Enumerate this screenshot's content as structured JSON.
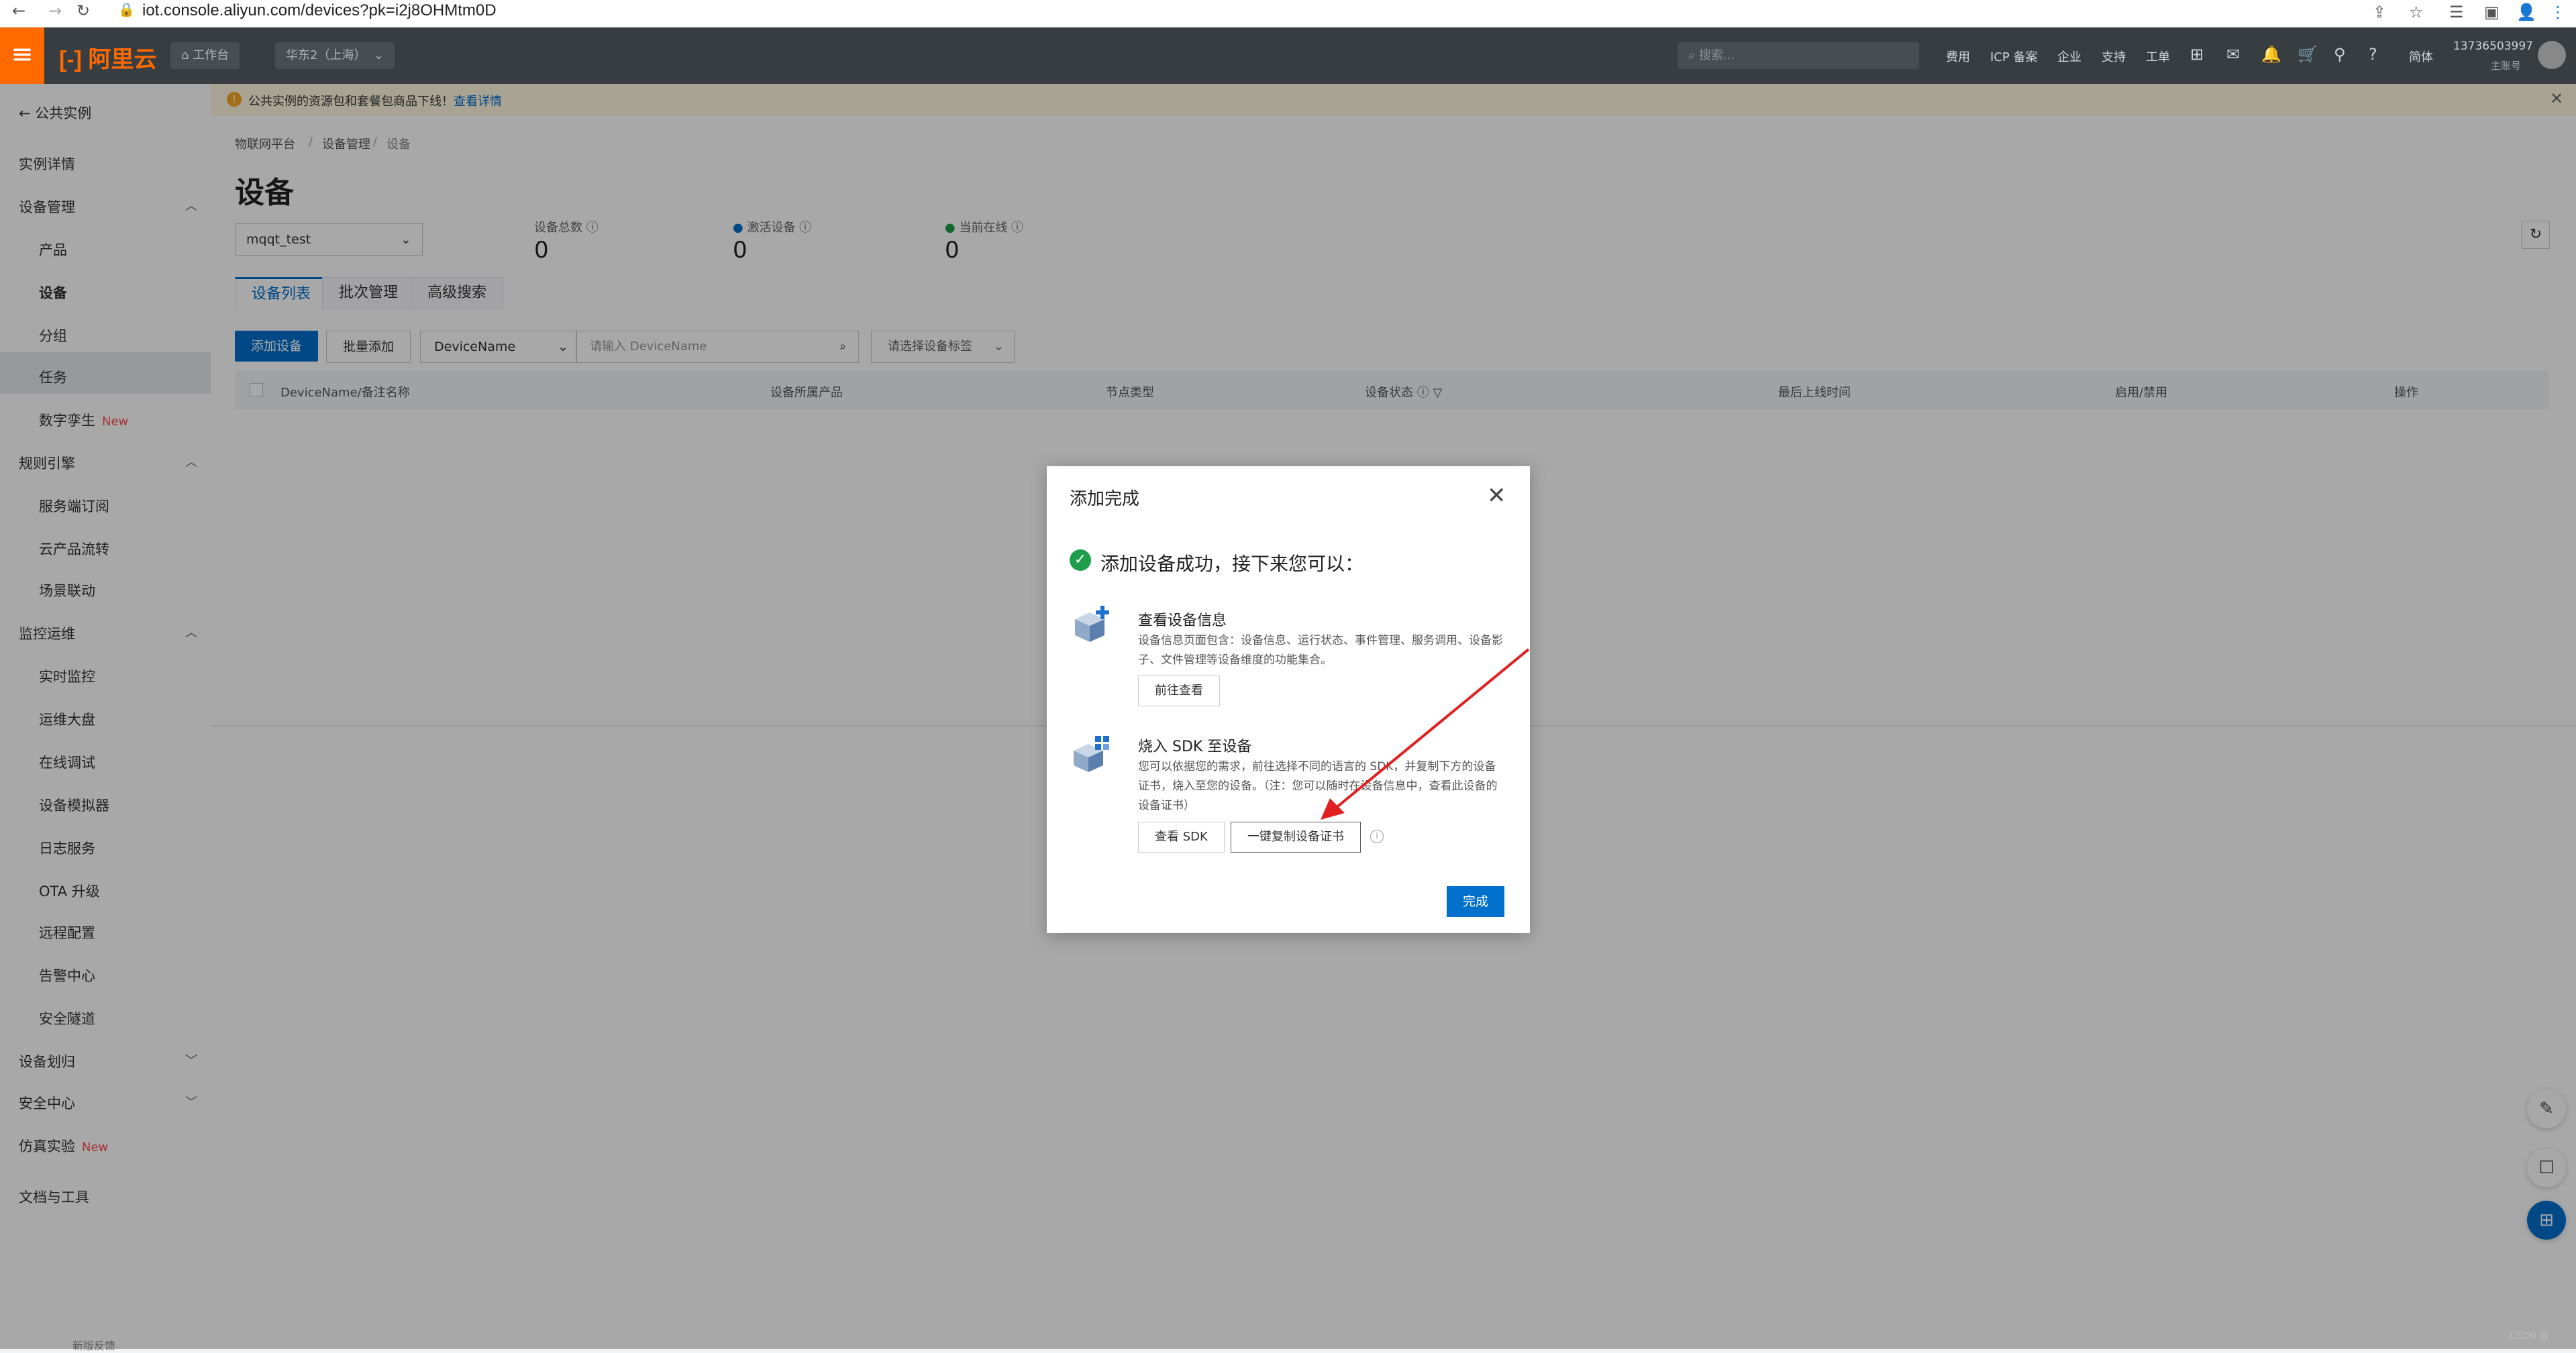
{
  "browser": {
    "url": "iot.console.aliyun.com/devices?pk=i2j8OHMtm0D"
  },
  "topbar": {
    "logo": "阿里云",
    "workbench": "工作台",
    "region": "华东2（上海）",
    "search_placeholder": "搜索...",
    "links": [
      "费用",
      "ICP 备案",
      "企业",
      "支持",
      "工单"
    ],
    "lang": "简体",
    "account_phone": "13736503997",
    "account_role": "主账号"
  },
  "notice": {
    "text": "公共实例的资源包和套餐包商品下线！",
    "link": "查看详情"
  },
  "sidebar": {
    "back": "公共实例",
    "instance_detail": "实例详情",
    "device_mgmt": "设备管理",
    "product": "产品",
    "device": "设备",
    "group": "分组",
    "task": "任务",
    "digital_twin": "数字孪生",
    "new_tag": "New",
    "rule_engine": "规则引擎",
    "server_subscribe": "服务端订阅",
    "cloud_flow": "云产品流转",
    "scene_linkage": "场景联动",
    "monitor_ops": "监控运维",
    "realtime_monitor": "实时监控",
    "ops_dashboard": "运维大盘",
    "online_debug": "在线调试",
    "device_simulator": "设备模拟器",
    "log_service": "日志服务",
    "ota": "OTA 升级",
    "remote_config": "远程配置",
    "alarm_center": "告警中心",
    "secure_tunnel": "安全隧道",
    "device_allocation": "设备划归",
    "security_center": "安全中心",
    "sim_experiment": "仿真实验",
    "docs_tools": "文档与工具",
    "bottom": "新版反馈"
  },
  "main": {
    "breadcrumb": [
      "物联网平台",
      "设备管理",
      "设备"
    ],
    "title": "设备",
    "product_select": "mqqt_test",
    "stats": [
      {
        "label": "设备总数",
        "value": "0"
      },
      {
        "label": "激活设备",
        "value": "0"
      },
      {
        "label": "当前在线",
        "value": "0"
      }
    ],
    "tabs": [
      "设备列表",
      "批次管理",
      "高级搜索"
    ],
    "add_device": "添加设备",
    "batch_add": "批量添加",
    "filter_field": "DeviceName",
    "search_placeholder": "请输入 DeviceName",
    "tag_select": "请选择设备标签",
    "columns": [
      "DeviceName/备注名称",
      "设备所属产品",
      "节点类型",
      "设备状态",
      "最后上线时间",
      "启用/禁用",
      "操作"
    ]
  },
  "modal": {
    "title": "添加完成",
    "success": "添加设备成功，接下来您可以：",
    "view_title": "查看设备信息",
    "view_desc": "设备信息页面包含：设备信息、运行状态、事件管理、服务调用、设备影子、文件管理等设备维度的功能集合。",
    "view_button": "前往查看",
    "sdk_title": "烧入 SDK 至设备",
    "sdk_desc": "您可以依据您的需求，前往选择不同的语言的 SDK，并复制下方的设备证书，烧入至您的设备。（注：您可以随时在设备信息中，查看此设备的设备证书）",
    "sdk_view_button": "查看 SDK",
    "copy_cert_button": "一键复制设备证书",
    "done_button": "完成"
  },
  "colors": {
    "brand": "#ff6a00",
    "primary": "#0070cc",
    "success": "#1e9e4a",
    "arrow": "#e02020"
  }
}
